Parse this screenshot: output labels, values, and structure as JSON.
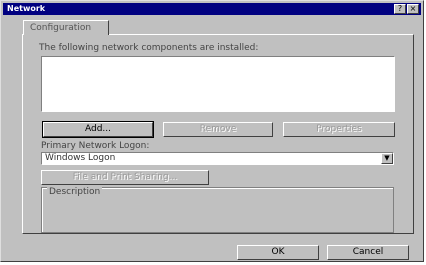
{
  "window": {
    "title": "Network",
    "help_btn": "?",
    "close_btn": "×"
  },
  "tabs": [
    {
      "label": "Configuration"
    }
  ],
  "components_label": "The following network components are installed:",
  "components": [],
  "buttons": {
    "add": "Add...",
    "remove": "Remove",
    "properties": "Properties"
  },
  "primary_logon": {
    "label": "Primary Network Logon:",
    "value": "Windows Logon"
  },
  "file_print_sharing": "File and Print Sharing...",
  "description_label": "Description",
  "dialog": {
    "ok": "OK",
    "cancel": "Cancel"
  }
}
